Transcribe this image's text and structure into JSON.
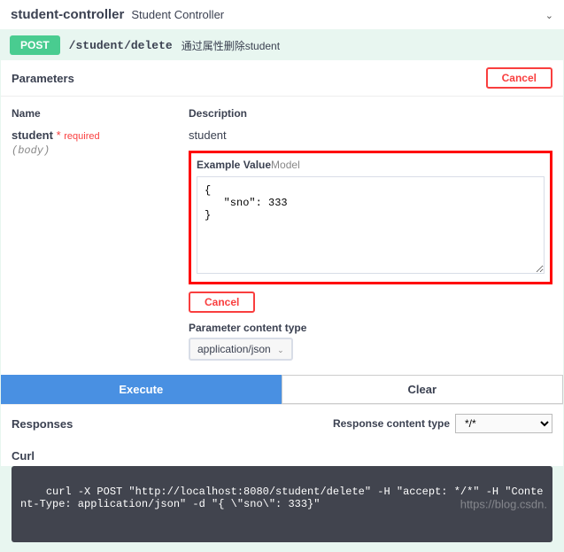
{
  "controller": {
    "name": "student-controller",
    "description": "Student Controller"
  },
  "operation": {
    "method": "POST",
    "path": "/student/delete",
    "description": "通过属性删除student"
  },
  "parametersSection": {
    "title": "Parameters",
    "cancel": "Cancel",
    "headers": {
      "name": "Name",
      "description": "Description"
    }
  },
  "param": {
    "name": "student",
    "requiredStar": "*",
    "requiredText": "required",
    "type": "(body)",
    "description": "student",
    "tabs": {
      "example": "Example Value",
      "model": "Model"
    },
    "body": "{\n   \"sno\": 333\n}",
    "cancelInline": "Cancel",
    "contentTypeLabel": "Parameter content type",
    "contentType": "application/json"
  },
  "buttons": {
    "execute": "Execute",
    "clear": "Clear"
  },
  "responses": {
    "title": "Responses",
    "contentTypeLabel": "Response content type",
    "contentType": "*/*"
  },
  "curl": {
    "title": "Curl",
    "command": "curl -X POST \"http://localhost:8080/student/delete\" -H \"accept: */*\" -H \"Content-Type: application/json\" -d \"{ \\\"sno\\\": 333}\""
  },
  "watermark": "https://blog.csdn."
}
